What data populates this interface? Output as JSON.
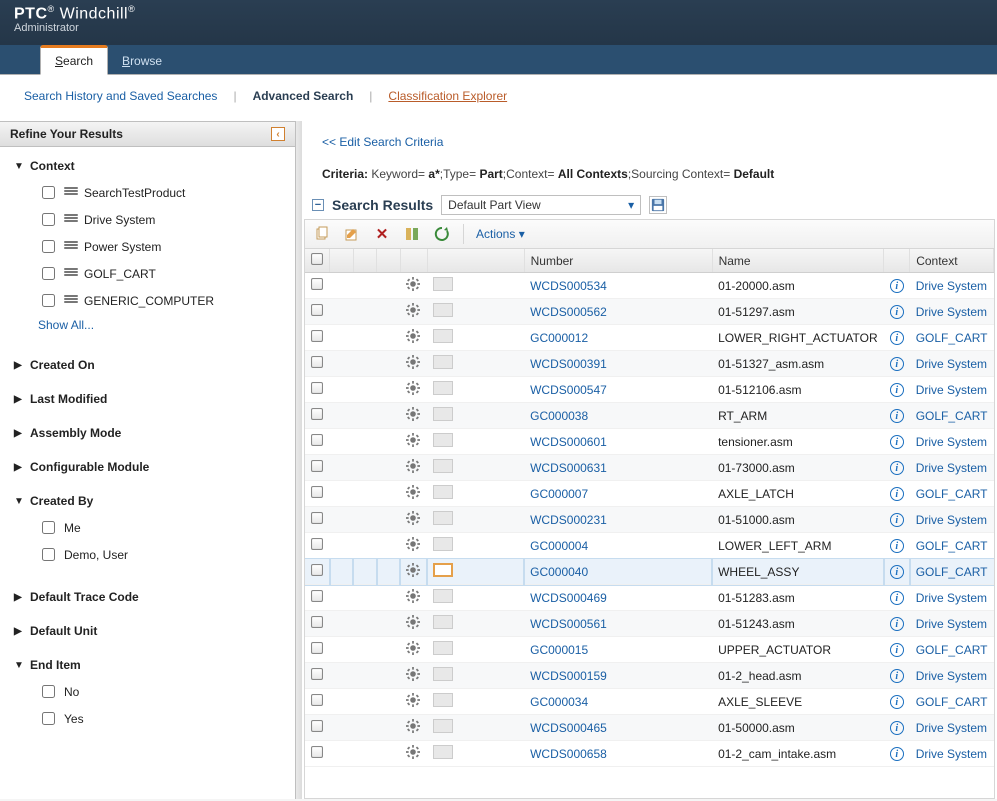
{
  "brand": {
    "line1_a": "PTC",
    "line1_b": "Windchill",
    "reg": "®",
    "sub": "Administrator"
  },
  "topTabs": {
    "search": "Search",
    "browse": "Browse"
  },
  "linkBar": {
    "history": "Search History and Saved Searches",
    "advanced": "Advanced Search",
    "explorer": "Classification Explorer"
  },
  "refine": {
    "title": "Refine Your Results",
    "facets": {
      "context": {
        "label": "Context",
        "items": [
          "SearchTestProduct",
          "Drive System",
          "Power System",
          "GOLF_CART",
          "GENERIC_COMPUTER"
        ],
        "showAll": "Show All..."
      },
      "createdOn": {
        "label": "Created On"
      },
      "lastModified": {
        "label": "Last Modified"
      },
      "assemblyMode": {
        "label": "Assembly Mode"
      },
      "configurableModule": {
        "label": "Configurable Module"
      },
      "createdBy": {
        "label": "Created By",
        "items": [
          "Me",
          "Demo, User"
        ]
      },
      "defaultTrace": {
        "label": "Default Trace Code"
      },
      "defaultUnit": {
        "label": "Default Unit"
      },
      "endItem": {
        "label": "End Item",
        "items": [
          "No",
          "Yes"
        ]
      }
    }
  },
  "results": {
    "editCriteria": "<<  Edit Search Criteria",
    "criteriaLabel": "Criteria:",
    "criteriaParts": {
      "p1": " Keyword= ",
      "v1": "a*",
      "p2": ";Type= ",
      "v2": "Part",
      "p3": ";Context= ",
      "v3": "All Contexts",
      "p4": ";Sourcing Context= ",
      "v4": "Default"
    },
    "searchResults": "Search Results",
    "viewSelect": "Default Part View",
    "actionsLabel": "Actions",
    "columns": {
      "number": "Number",
      "name": "Name",
      "context": "Context"
    },
    "rows": [
      {
        "number": "WCDS000534",
        "name": "01-20000.asm",
        "context": "Drive System"
      },
      {
        "number": "WCDS000562",
        "name": "01-51297.asm",
        "context": "Drive System"
      },
      {
        "number": "GC000012",
        "name": "LOWER_RIGHT_ACTUATOR",
        "context": "GOLF_CART"
      },
      {
        "number": "WCDS000391",
        "name": "01-51327_asm.asm",
        "context": "Drive System"
      },
      {
        "number": "WCDS000547",
        "name": "01-512106.asm",
        "context": "Drive System"
      },
      {
        "number": "GC000038",
        "name": "RT_ARM",
        "context": "GOLF_CART"
      },
      {
        "number": "WCDS000601",
        "name": "tensioner.asm",
        "context": "Drive System"
      },
      {
        "number": "WCDS000631",
        "name": "01-73000.asm",
        "context": "Drive System"
      },
      {
        "number": "GC000007",
        "name": "AXLE_LATCH",
        "context": "GOLF_CART"
      },
      {
        "number": "WCDS000231",
        "name": "01-51000.asm",
        "context": "Drive System"
      },
      {
        "number": "GC000004",
        "name": "LOWER_LEFT_ARM",
        "context": "GOLF_CART"
      },
      {
        "number": "GC000040",
        "name": "WHEEL_ASSY",
        "context": "GOLF_CART",
        "highlight": true
      },
      {
        "number": "WCDS000469",
        "name": "01-51283.asm",
        "context": "Drive System"
      },
      {
        "number": "WCDS000561",
        "name": "01-51243.asm",
        "context": "Drive System"
      },
      {
        "number": "GC000015",
        "name": "UPPER_ACTUATOR",
        "context": "GOLF_CART"
      },
      {
        "number": "WCDS000159",
        "name": "01-2_head.asm",
        "context": "Drive System"
      },
      {
        "number": "GC000034",
        "name": "AXLE_SLEEVE",
        "context": "GOLF_CART"
      },
      {
        "number": "WCDS000465",
        "name": "01-50000.asm",
        "context": "Drive System"
      },
      {
        "number": "WCDS000658",
        "name": "01-2_cam_intake.asm",
        "context": "Drive System"
      }
    ]
  }
}
